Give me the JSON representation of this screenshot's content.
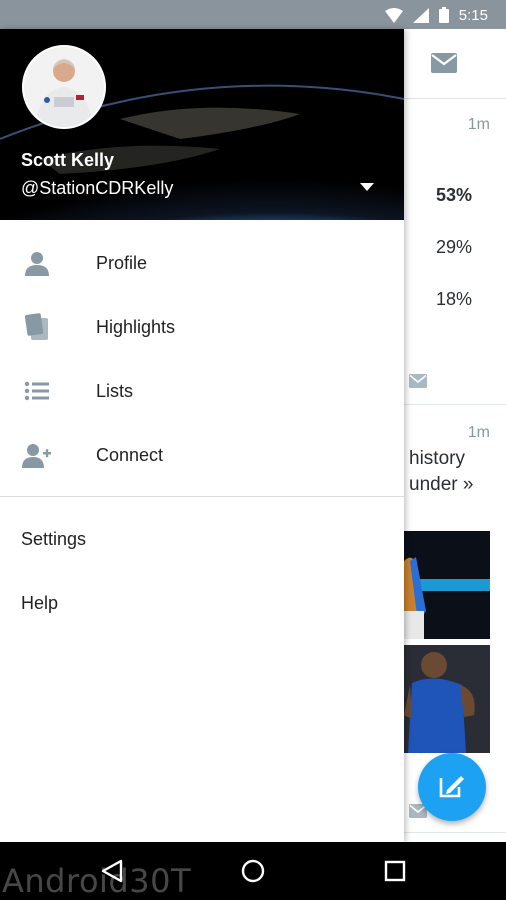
{
  "status_bar": {
    "time": "5:15",
    "icons": [
      "wifi-icon",
      "signal-icon",
      "battery-icon"
    ]
  },
  "drawer": {
    "user": {
      "name": "Scott Kelly",
      "handle": "@StationCDRKelly"
    },
    "menu_items": [
      {
        "label": "Profile",
        "icon": "person-icon"
      },
      {
        "label": "Highlights",
        "icon": "highlights-icon"
      },
      {
        "label": "Lists",
        "icon": "list-icon"
      },
      {
        "label": "Connect",
        "icon": "add-person-icon"
      }
    ],
    "secondary_items": [
      {
        "label": "Settings"
      },
      {
        "label": "Help"
      }
    ]
  },
  "timeline": {
    "tweet1": {
      "time": "1m",
      "poll": [
        "53%",
        "29%",
        "18%"
      ]
    },
    "tweet2": {
      "time": "1m",
      "text_lines": [
        "history",
        "under »"
      ]
    }
  },
  "nav_bar": {
    "buttons": [
      "back-icon",
      "home-icon",
      "recents-icon"
    ]
  },
  "watermark": "Android30T",
  "colors": {
    "accent": "#1da1f2",
    "status_bar": "#8a949c",
    "icon_gray": "#8899a6"
  }
}
